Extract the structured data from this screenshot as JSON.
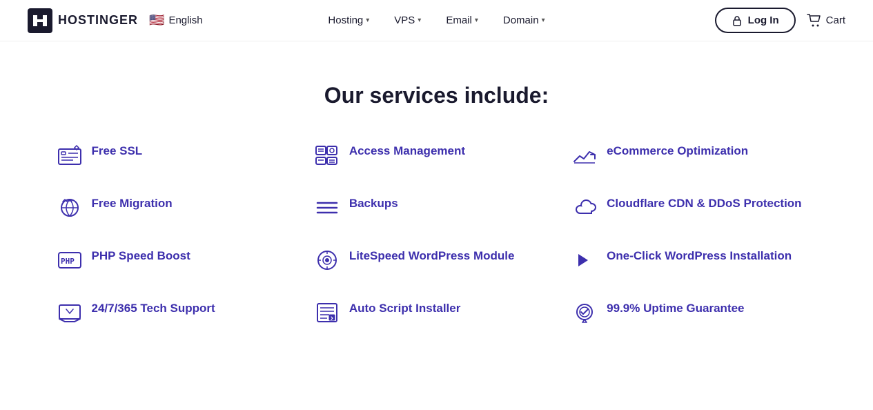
{
  "header": {
    "logo_text": "HOSTINGER",
    "lang": "English",
    "nav": [
      {
        "label": "Hosting",
        "id": "hosting"
      },
      {
        "label": "VPS",
        "id": "vps"
      },
      {
        "label": "Email",
        "id": "email"
      },
      {
        "label": "Domain",
        "id": "domain"
      }
    ],
    "login_label": "Log In",
    "cart_label": "Cart"
  },
  "main": {
    "section_title": "Our services include:",
    "services": [
      {
        "id": "free-ssl",
        "label": "Free SSL",
        "icon": "ssl"
      },
      {
        "id": "access-management",
        "label": "Access Management",
        "icon": "access"
      },
      {
        "id": "ecommerce",
        "label": "eCommerce Optimization",
        "icon": "ecommerce"
      },
      {
        "id": "free-migration",
        "label": "Free Migration",
        "icon": "migration"
      },
      {
        "id": "backups",
        "label": "Backups",
        "icon": "backups"
      },
      {
        "id": "cloudflare",
        "label": "Cloudflare CDN & DDoS Protection",
        "icon": "cloudflare"
      },
      {
        "id": "php-speed",
        "label": "PHP Speed Boost",
        "icon": "php"
      },
      {
        "id": "litespeed",
        "label": "LiteSpeed WordPress Module",
        "icon": "litespeed"
      },
      {
        "id": "one-click-wp",
        "label": "One-Click WordPress Installation",
        "icon": "wordpress"
      },
      {
        "id": "tech-support",
        "label": "24/7/365 Tech Support",
        "icon": "support"
      },
      {
        "id": "auto-script",
        "label": "Auto Script Installer",
        "icon": "script"
      },
      {
        "id": "uptime",
        "label": "99.9% Uptime Guarantee",
        "icon": "uptime"
      }
    ]
  }
}
